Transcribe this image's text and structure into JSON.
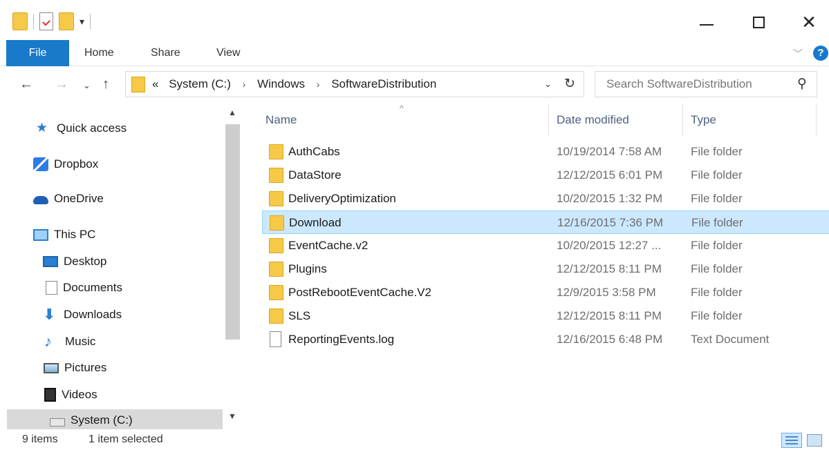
{
  "window": {
    "minimize_icon": "minimize-icon",
    "maximize_icon": "maximize-icon",
    "close_glyph": "✕"
  },
  "ribbon": {
    "tabs": [
      "File",
      "Home",
      "Share",
      "View"
    ],
    "expand_glyph": "﹀",
    "help_glyph": "?"
  },
  "nav": {
    "back_glyph": "←",
    "forward_glyph": "→",
    "recent_glyph": "⌄",
    "up_glyph": "↑",
    "breadcrumb": {
      "overflow": "«",
      "parts": [
        "System (C:)",
        "Windows",
        "SoftwareDistribution"
      ],
      "separator": "›"
    },
    "dropdown_glyph": "⌄",
    "refresh_glyph": "↻",
    "search_placeholder": "Search SoftwareDistribution",
    "search_glyph": "⚲"
  },
  "sidebar": {
    "items": [
      {
        "label": "Quick access",
        "icon": "star-icon"
      },
      {
        "label": "Dropbox",
        "icon": "dropbox-icon"
      },
      {
        "label": "OneDrive",
        "icon": "onedrive-icon"
      },
      {
        "label": "This PC",
        "icon": "pc-icon"
      },
      {
        "label": "Desktop",
        "icon": "desktop-icon"
      },
      {
        "label": "Documents",
        "icon": "documents-icon"
      },
      {
        "label": "Downloads",
        "icon": "downloads-icon"
      },
      {
        "label": "Music",
        "icon": "music-icon"
      },
      {
        "label": "Pictures",
        "icon": "pictures-icon"
      },
      {
        "label": "Videos",
        "icon": "videos-icon"
      },
      {
        "label": "System (C:)",
        "icon": "drive-icon"
      }
    ],
    "selected": "System (C:)"
  },
  "filelist": {
    "columns": {
      "name": "Name",
      "date": "Date modified",
      "type": "Type"
    },
    "sort_glyph": "^",
    "rows": [
      {
        "name": "AuthCabs",
        "date": "10/19/2014 7:58 AM",
        "type": "File folder",
        "kind": "folder"
      },
      {
        "name": "DataStore",
        "date": "12/12/2015 6:01 PM",
        "type": "File folder",
        "kind": "folder"
      },
      {
        "name": "DeliveryOptimization",
        "date": "10/20/2015 1:32 PM",
        "type": "File folder",
        "kind": "folder"
      },
      {
        "name": "Download",
        "date": "12/16/2015 7:36 PM",
        "type": "File folder",
        "kind": "folder",
        "selected": true
      },
      {
        "name": "EventCache.v2",
        "date": "10/20/2015 12:27 ...",
        "type": "File folder",
        "kind": "folder"
      },
      {
        "name": "Plugins",
        "date": "12/12/2015 8:11 PM",
        "type": "File folder",
        "kind": "folder"
      },
      {
        "name": "PostRebootEventCache.V2",
        "date": "12/9/2015 3:58 PM",
        "type": "File folder",
        "kind": "folder"
      },
      {
        "name": "SLS",
        "date": "12/12/2015 8:11 PM",
        "type": "File folder",
        "kind": "folder"
      },
      {
        "name": "ReportingEvents.log",
        "date": "12/16/2015 6:48 PM",
        "type": "Text Document",
        "kind": "file"
      }
    ]
  },
  "status": {
    "count": "9 items",
    "selection": "1 item selected"
  },
  "colors": {
    "accent": "#1979ca",
    "selection_bg": "#cce8ff",
    "selection_border": "#99d1ff",
    "folder": "#f7c948"
  }
}
